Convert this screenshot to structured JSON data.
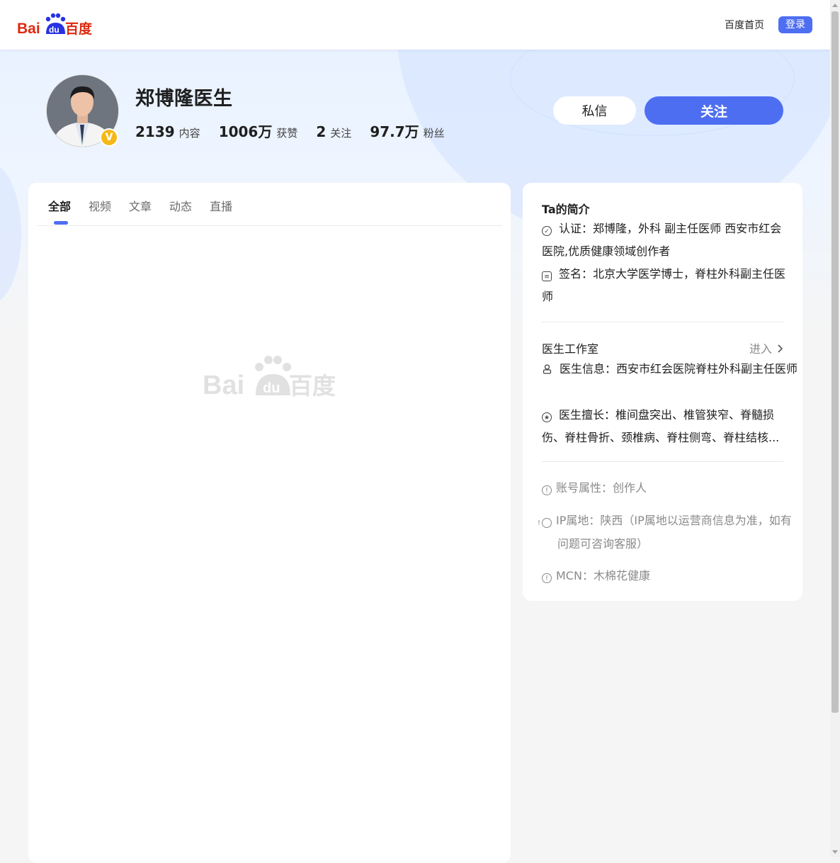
{
  "header": {
    "logo_text": "Bai百度",
    "nav_home": "百度首页",
    "login": "登录"
  },
  "profile": {
    "name": "郑博隆医生",
    "verified_badge": "V",
    "stats": [
      {
        "num": "2139",
        "label": "内容"
      },
      {
        "num": "1006万",
        "label": "获赞"
      },
      {
        "num": "2",
        "label": "关注"
      },
      {
        "num": "97.7万",
        "label": "粉丝"
      }
    ],
    "message_button": "私信",
    "follow_button": "关注"
  },
  "tabs": [
    "全部",
    "视频",
    "文章",
    "动态",
    "直播"
  ],
  "intro": {
    "title": "Ta的简介",
    "cert_label": "认证：",
    "cert_text": "郑博隆，外科 副主任医师 西安市红会医院,优质健康领域创作者",
    "sign_label": "签名：",
    "sign_text": "北京大学医学博士，脊柱外科副主任医师"
  },
  "studio": {
    "title": "医生工作室",
    "enter": "进入",
    "info_label": "医生信息：",
    "info_text": "西安市红会医院脊柱外科副主任医师",
    "skill_label": "医生擅长：",
    "skill_text": "椎间盘突出、椎管狭窄、脊髓损伤、脊柱骨折、颈椎病、脊柱侧弯、脊柱结核..."
  },
  "meta": {
    "account_type": "账号属性：创作人",
    "ip_location": "IP属地：陕西（IP属地以运营商信息为准，如有问题可咨询客服）",
    "mcn": "MCN：木棉花健康"
  },
  "colors": {
    "brand_blue": "#4e6ef2",
    "baidu_red": "#de2910",
    "baidu_blue": "#2932e1",
    "badge_gold": "#f5b816"
  }
}
